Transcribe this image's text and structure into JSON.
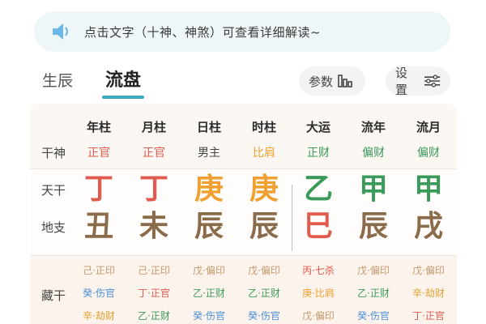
{
  "notice": {
    "text": "点击文字（十神、神煞）可查看详细解读~",
    "icon": "speaker-icon"
  },
  "tabs": [
    {
      "label": "生辰",
      "active": false
    },
    {
      "label": "流盘",
      "active": true
    }
  ],
  "buttons": {
    "params": "参数",
    "settings": "设置"
  },
  "row_labels": {
    "shishen": "干神",
    "tiangan": "天干",
    "dizhi": "地支",
    "canggan": "藏干"
  },
  "columns": [
    {
      "header": "年柱",
      "shen": "正官",
      "shen_color": "#e05a4e",
      "gan": "丁",
      "gan_color": "#e05a4e",
      "zhi": "丑",
      "zhi_color": "#8a6b4a",
      "cang": [
        {
          "t": "己·正印",
          "c": "#c49a6c"
        },
        {
          "t": "癸·伤官",
          "c": "#4a90d9"
        },
        {
          "t": "辛·劫财",
          "c": "#e0a030"
        }
      ]
    },
    {
      "header": "月柱",
      "shen": "正官",
      "shen_color": "#e05a4e",
      "gan": "丁",
      "gan_color": "#e05a4e",
      "zhi": "未",
      "zhi_color": "#8a6b4a",
      "cang": [
        {
          "t": "己·正印",
          "c": "#c49a6c"
        },
        {
          "t": "丁·正官",
          "c": "#e05a4e"
        },
        {
          "t": "乙·正财",
          "c": "#3a9a5a"
        }
      ]
    },
    {
      "header": "日柱",
      "shen": "男主",
      "shen_color": "#444444",
      "gan": "庚",
      "gan_color": "#f0a030",
      "zhi": "辰",
      "zhi_color": "#8a6b4a",
      "cang": [
        {
          "t": "戊·偏印",
          "c": "#c49a6c"
        },
        {
          "t": "乙·正财",
          "c": "#3a9a5a"
        },
        {
          "t": "癸·伤官",
          "c": "#4a90d9"
        }
      ]
    },
    {
      "header": "时柱",
      "shen": "比肩",
      "shen_color": "#f0a030",
      "gan": "庚",
      "gan_color": "#f0a030",
      "zhi": "辰",
      "zhi_color": "#8a6b4a",
      "cang": [
        {
          "t": "戊·偏印",
          "c": "#c49a6c"
        },
        {
          "t": "乙·正财",
          "c": "#3a9a5a"
        },
        {
          "t": "癸·伤官",
          "c": "#4a90d9"
        }
      ]
    },
    {
      "header": "大运",
      "shen": "正财",
      "shen_color": "#3a9a5a",
      "gan": "乙",
      "gan_color": "#3a9a5a",
      "zhi": "巳",
      "zhi_color": "#e05a4e",
      "cang": [
        {
          "t": "丙·七杀",
          "c": "#e05a4e"
        },
        {
          "t": "庚·比肩",
          "c": "#f0a030"
        },
        {
          "t": "戊·偏印",
          "c": "#c49a6c"
        }
      ]
    },
    {
      "header": "流年",
      "shen": "偏财",
      "shen_color": "#3a9a5a",
      "gan": "甲",
      "gan_color": "#3a9a5a",
      "zhi": "辰",
      "zhi_color": "#8a6b4a",
      "cang": [
        {
          "t": "戊·偏印",
          "c": "#c49a6c"
        },
        {
          "t": "乙·正财",
          "c": "#3a9a5a"
        },
        {
          "t": "癸·伤官",
          "c": "#4a90d9"
        }
      ]
    },
    {
      "header": "流月",
      "shen": "偏财",
      "shen_color": "#3a9a5a",
      "gan": "甲",
      "gan_color": "#3a9a5a",
      "zhi": "戌",
      "zhi_color": "#8a6b4a",
      "cang": [
        {
          "t": "戊·偏印",
          "c": "#c49a6c"
        },
        {
          "t": "辛·劫财",
          "c": "#e0a030"
        },
        {
          "t": "丁·正官",
          "c": "#e05a4e"
        }
      ]
    }
  ]
}
